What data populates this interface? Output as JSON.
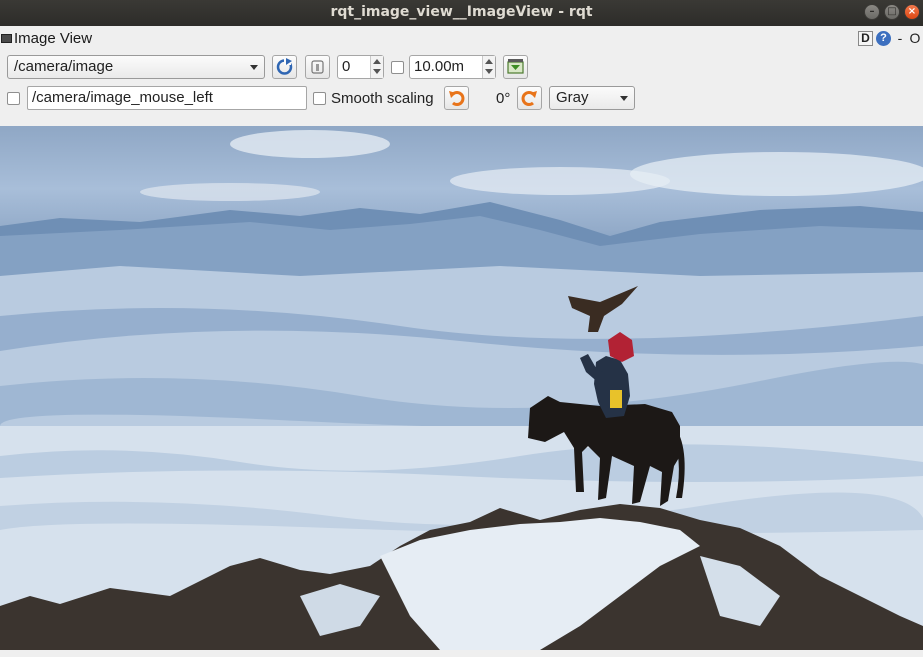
{
  "window": {
    "title": "rqt_image_view__ImageView - rqt"
  },
  "plugin": {
    "title": "Image View",
    "help_d": "D",
    "help_q": "?",
    "minus": "-",
    "close": "O"
  },
  "toolbar": {
    "topic": "/camera/image",
    "decimation": "0",
    "timeout": "10.00m",
    "mouse_topic": "/camera/image_mouse_left",
    "smooth_scaling_label": "Smooth scaling",
    "rotation": "0°",
    "color_mode": "Gray"
  },
  "image": {
    "description_icons": [
      "refresh-icon",
      "zoom-icon",
      "save-image-icon",
      "rotate-left-icon",
      "rotate-right-icon"
    ],
    "colors": {
      "sky": "#a8bed9",
      "mountains": "#6c8db3",
      "snow": "#d8e3ee",
      "rock": "#3a3430"
    }
  }
}
